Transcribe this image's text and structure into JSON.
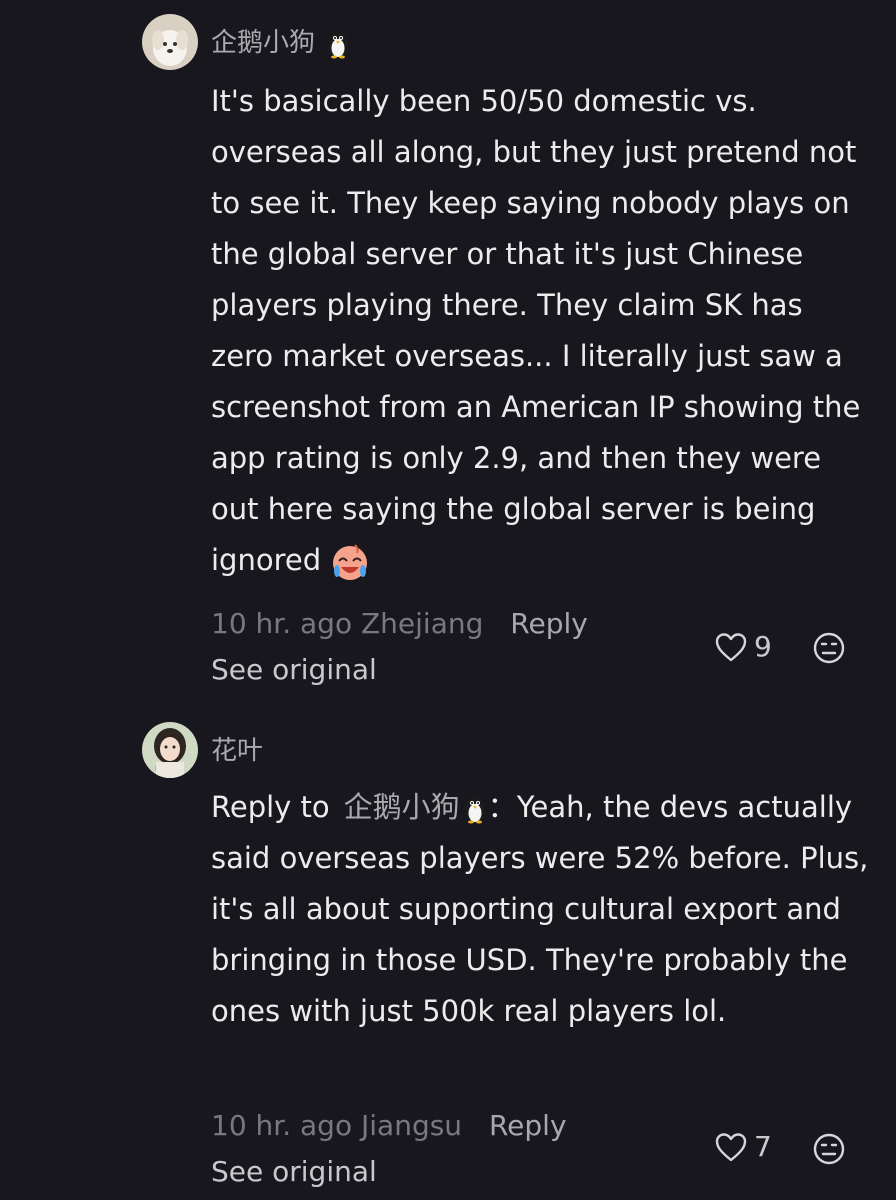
{
  "comments": [
    {
      "username": "企鹅小狗",
      "text": "It's basically been 50/50 domestic vs. overseas all along, but they just pretend not to see it. They keep saying nobody plays on the global server or that it's just Chinese players playing there. They claim SK has zero market overseas... I literally just saw a screenshot from an American IP showing the app rating is only 2.9, and then they were out here saying the global server is being ignored",
      "time": "10 hr. ago",
      "location": "Zhejiang",
      "reply_label": "Reply",
      "likes": "9",
      "see_original": "See original"
    },
    {
      "username": "花叶",
      "reply_prefix": "Reply to",
      "reply_to": "企鹅小狗",
      "reply_sep": "：",
      "text": "Yeah, the devs actually said overseas players were 52% before. Plus, it's all about supporting cultural export and bringing in those USD. They're probably the ones with just 500k real players lol.",
      "time": "10 hr. ago",
      "location": "Jiangsu",
      "reply_label": "Reply",
      "likes": "7",
      "see_original": "See original"
    }
  ],
  "icons": {
    "like": "heart-outline-icon",
    "dislike": "unhappy-face-icon",
    "penguin": "penguin-emoji",
    "laugh_cry": "laughing-crying-emoji"
  }
}
